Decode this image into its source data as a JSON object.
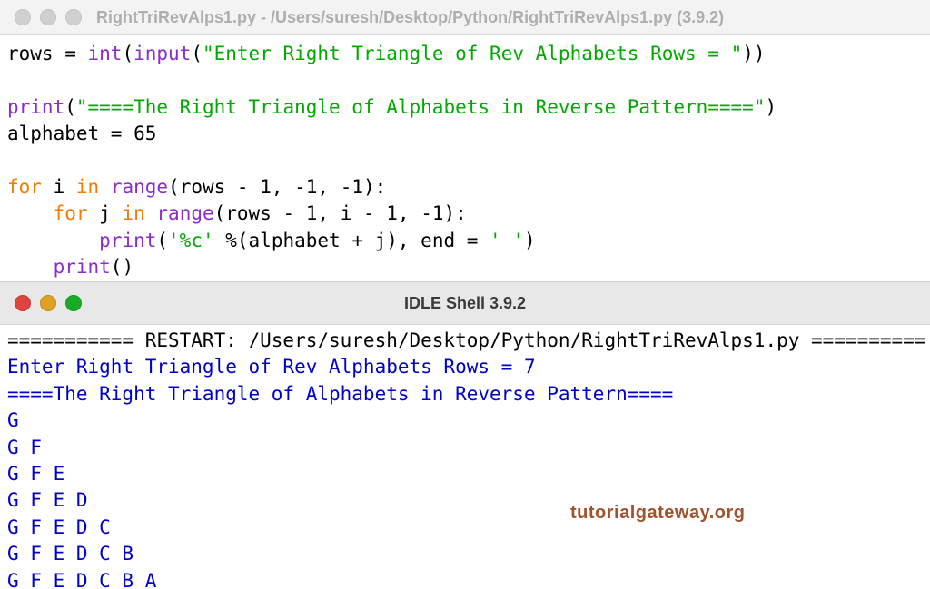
{
  "editor": {
    "title": "RightTriRevAlps1.py - /Users/suresh/Desktop/Python/RightTriRevAlps1.py (3.9.2)",
    "lines": {
      "l1": {
        "a": "rows = ",
        "b": "int",
        "c": "(",
        "d": "input",
        "e": "(",
        "f": "\"Enter Right Triangle of Rev Alphabets Rows = \"",
        "g": "))"
      },
      "l2": {
        "a": "print",
        "b": "(",
        "c": "\"====The Right Triangle of Alphabets in Reverse Pattern====\"",
        "d": ")"
      },
      "l3": "alphabet = 65",
      "l4": {
        "a": "for",
        "b": " i ",
        "c": "in",
        "d": " ",
        "e": "range",
        "f": "(rows - 1, -1, -1):"
      },
      "l5": {
        "indent": "    ",
        "a": "for",
        "b": " j ",
        "c": "in",
        "d": " ",
        "e": "range",
        "f": "(rows - 1, i - 1, -1):"
      },
      "l6": {
        "indent": "        ",
        "a": "print",
        "b": "(",
        "c": "'%c'",
        "d": " %(alphabet + j), end = ",
        "e": "' '",
        "f": ")"
      },
      "l7": {
        "indent": "    ",
        "a": "print",
        "b": "()"
      }
    }
  },
  "shell": {
    "title": "IDLE Shell 3.9.2",
    "restart": "=========== RESTART: /Users/suresh/Desktop/Python/RightTriRevAlps1.py ==========",
    "prompt": "Enter Right Triangle of Rev Alphabets Rows = 7",
    "header": "====The Right Triangle of Alphabets in Reverse Pattern====",
    "output": [
      "G",
      "G F",
      "G F E",
      "G F E D",
      "G F E D C",
      "G F E D C B",
      "G F E D C B A"
    ]
  },
  "watermark": "tutorialgateway.org",
  "colors": {
    "keyword": "#f47a00",
    "builtin": "#8e2bcc",
    "string": "#00aa00",
    "output": "#0000cc"
  }
}
